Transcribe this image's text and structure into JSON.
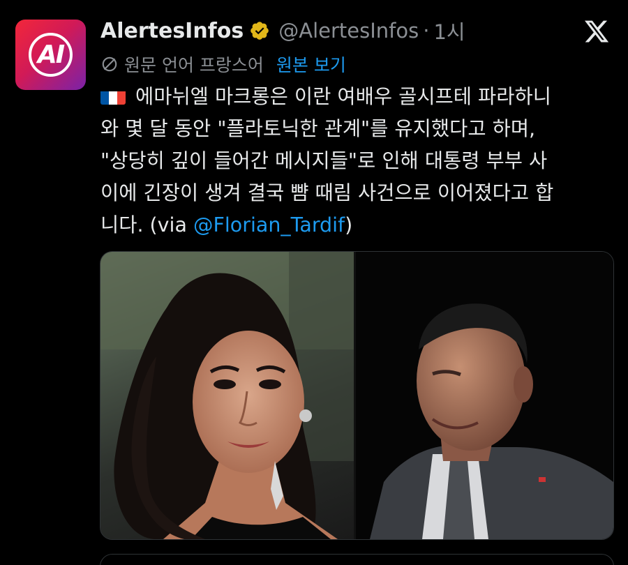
{
  "tweet": {
    "author_name": "AlertesInfos",
    "handle": "@AlertesInfos",
    "separator": "·",
    "time": "1시",
    "avatar_text": "AI",
    "translation": {
      "original_language": "원문 언어 프랑스어",
      "view_original": "원본 보기"
    },
    "body_lines": [
      "에마뉘엘 마크롱은 이란 여배우 골시프테 파라하니",
      "와 몇 달 동안 \"플라토닉한 관계\"를 유지했다고 하며,",
      "\"상당히 깊이 들어간 메시지들\"로 인해 대통령 부부 사",
      "이에 긴장이 생겨 결국 뺨 때림 사건으로 이어졌다고 합"
    ],
    "last_line": {
      "prefix": "니다. (via ",
      "mention": "@Florian_Tardif",
      "suffix": ")"
    }
  },
  "colors": {
    "background": "#000000",
    "text": "#e7e9ea",
    "muted": "#8b8f94",
    "link": "#1d9bf0",
    "verified_badge": "#e2b719"
  },
  "icons": {
    "verified": "verified-badge-icon",
    "platform": "x-logo-icon",
    "translate": "translate-globe-icon",
    "flag": "france-flag-icon"
  }
}
